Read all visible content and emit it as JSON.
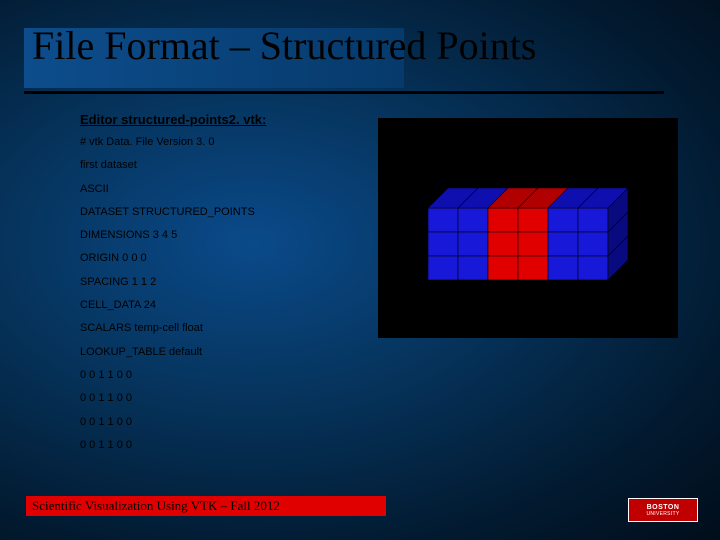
{
  "title": "File Format – Structured Points",
  "file_heading": "Editor structured-points2. vtk:",
  "lines": [
    "# vtk Data. File Version 3. 0",
    "first dataset",
    "ASCII",
    "DATASET STRUCTURED_POINTS",
    "DIMENSIONS 3 4 5",
    "ORIGIN 0 0 0",
    "SPACING 1 1 2",
    "CELL_DATA 24",
    "SCALARS temp-cell float",
    "LOOKUP_TABLE default",
    "0 0 1 1 0 0",
    "0 0 1 1 0 0",
    "0 0 1 1 0 0",
    "0 0 1 1 0 0"
  ],
  "footer": "Scientific Visualization Using VTK – Fall 2012",
  "logo": {
    "top": "BOSTON",
    "bottom": "UNIVERSITY"
  },
  "colors": {
    "blue_cell": "#1818d8",
    "red_cell": "#e00000",
    "edge": "#000"
  }
}
